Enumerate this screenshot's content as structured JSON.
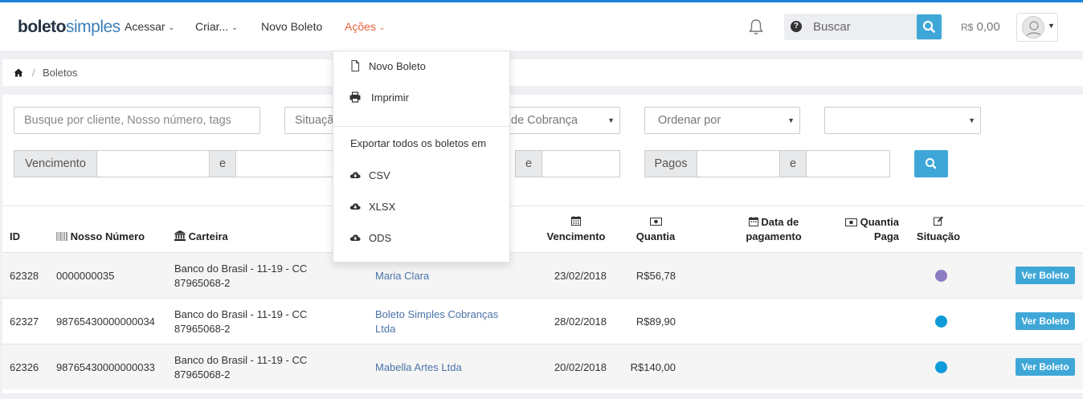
{
  "brand": {
    "bold": "boleto",
    "light": "simples"
  },
  "nav": {
    "acessar": "Acessar",
    "criar": "Criar...",
    "novo_boleto": "Novo Boleto",
    "acoes": "Ações"
  },
  "search": {
    "placeholder": "Buscar"
  },
  "balance": {
    "currency": "R$",
    "amount": "0,00"
  },
  "breadcrumb": {
    "current": "Boletos"
  },
  "filters": {
    "search_placeholder": "Busque por cliente, Nosso número, tags",
    "situacao": "Situação",
    "cobranca": "de Cobrança",
    "ordenar": "Ordenar por",
    "vencimento": "Vencimento",
    "e": "e",
    "pagos": "Pagos"
  },
  "table": {
    "headers": {
      "id": "ID",
      "nosso_numero": "Nosso Número",
      "carteira": "Carteira",
      "vencimento": "Vencimento",
      "quantia": "Quantia",
      "data_pag_1": "Data de",
      "data_pag_2": "pagamento",
      "quantia_paga_1": "Quantia",
      "quantia_paga_2": "Paga",
      "situacao": "Situação"
    },
    "rows": [
      {
        "id": "62328",
        "nosso": "0000000035",
        "carteira_1": "Banco do Brasil - 11-19 - CC",
        "carteira_2": "87965068-2",
        "cliente_1": "Maria Clara",
        "cliente_2": "",
        "vencimento": "23/02/2018",
        "quantia": "R$56,78",
        "status_color": "#8e7cc3",
        "action": "Ver Boleto"
      },
      {
        "id": "62327",
        "nosso": "98765430000000034",
        "carteira_1": "Banco do Brasil - 11-19 - CC",
        "carteira_2": "87965068-2",
        "cliente_1": "Boleto Simples Cobranças",
        "cliente_2": "Ltda",
        "vencimento": "28/02/2018",
        "quantia": "R$89,90",
        "status_color": "#0f9ad8",
        "action": "Ver Boleto"
      },
      {
        "id": "62326",
        "nosso": "98765430000000033",
        "carteira_1": "Banco do Brasil - 11-19 - CC",
        "carteira_2": "87965068-2",
        "cliente_1": "Mabella Artes Ltda",
        "cliente_2": "",
        "vencimento": "20/02/2018",
        "quantia": "R$140,00",
        "status_color": "#0f9ad8",
        "action": "Ver Boleto"
      }
    ]
  },
  "dropdown": {
    "novo_boleto": "Novo Boleto",
    "imprimir": "Imprimir",
    "export_header": "Exportar todos os boletos em",
    "csv": "CSV",
    "xlsx": "XLSX",
    "ods": "ODS"
  },
  "colors": {
    "accent": "#3fa7d8",
    "active_nav": "#e8603f",
    "top_stripe": "#1a82d8"
  }
}
